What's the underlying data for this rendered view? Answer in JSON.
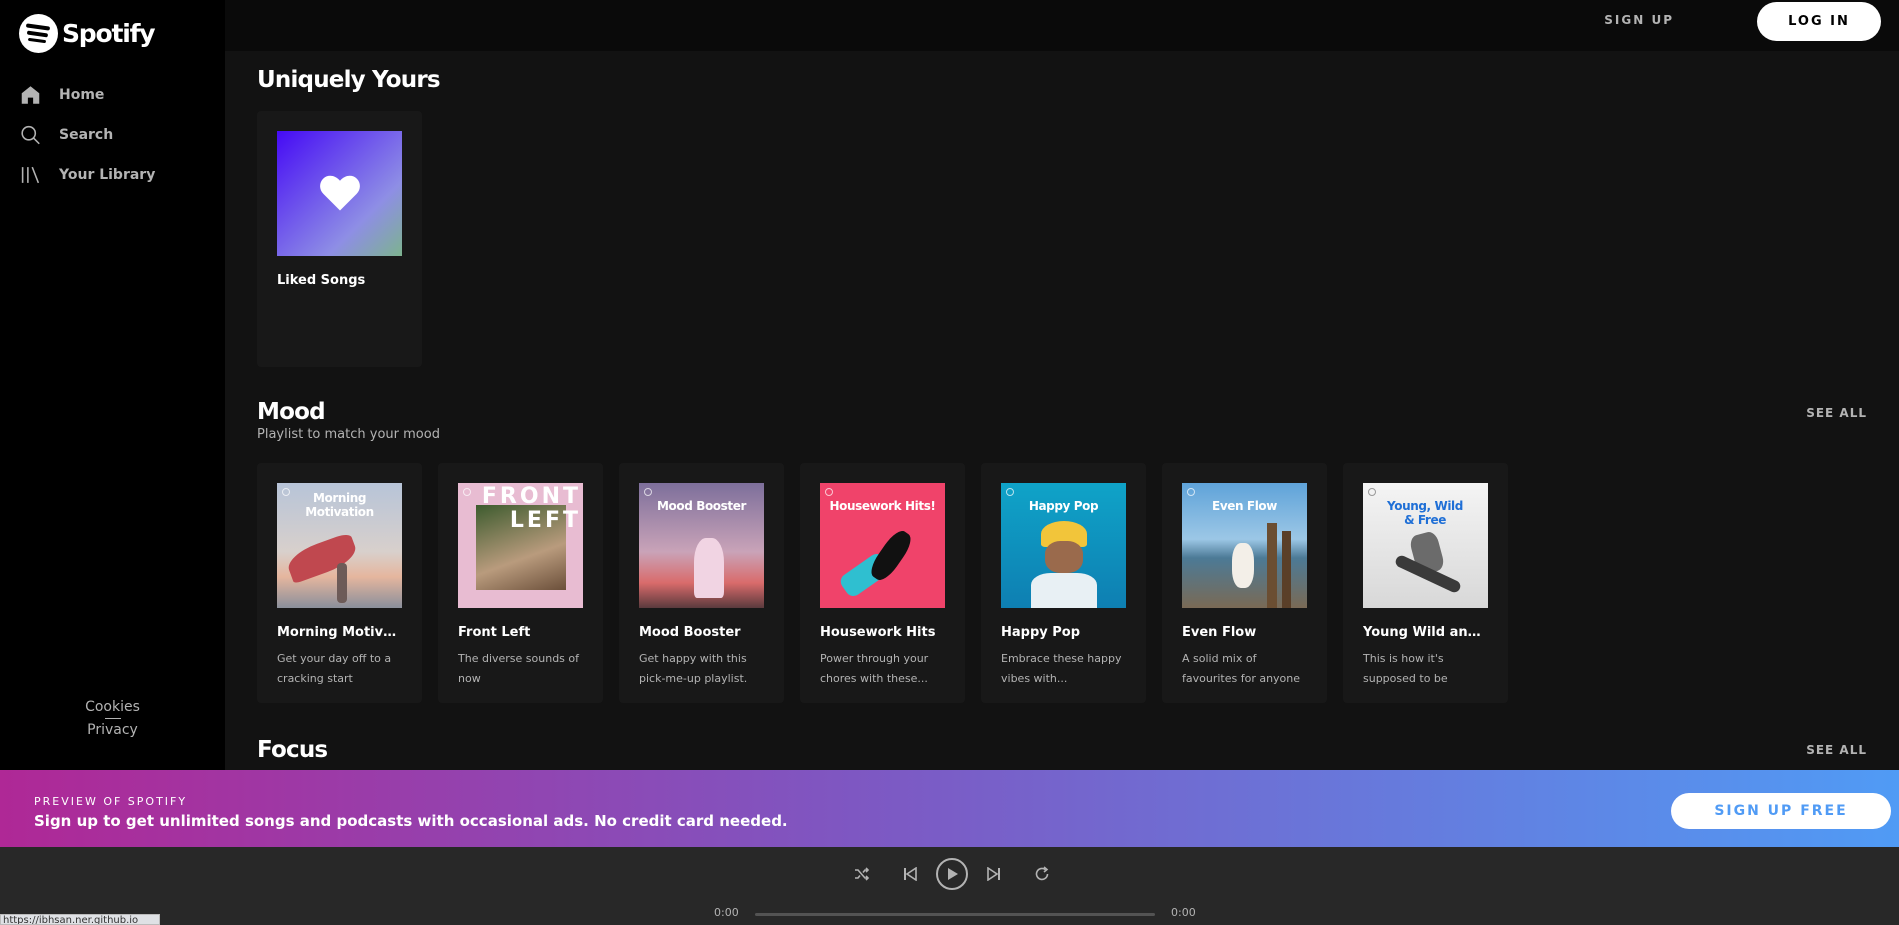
{
  "sidebar": {
    "logo_text": "Spotify",
    "items": [
      {
        "label": "Home",
        "icon": "home-icon"
      },
      {
        "label": "Search",
        "icon": "search-icon"
      },
      {
        "label": "Your Library",
        "icon": "library-icon"
      }
    ],
    "links": [
      "Cookies",
      "Privacy"
    ]
  },
  "topbar": {
    "signup_label": "SIGN UP",
    "login_label": "LOG IN"
  },
  "sections": {
    "uniquely": {
      "title": "Uniquely Yours",
      "cards": [
        {
          "title": "Liked Songs",
          "icon": "heart-icon"
        }
      ]
    },
    "mood": {
      "title": "Mood",
      "subtitle": "Playlist to match your mood",
      "see_all": "SEE ALL",
      "cards": [
        {
          "title": "Morning Motiva...",
          "desc": "Get your day off to a cracking start",
          "cover_text": "Morning Motivation"
        },
        {
          "title": "Front Left",
          "desc": "The diverse sounds of now",
          "cover_text": "FRONT LEFT"
        },
        {
          "title": "Mood Booster",
          "desc": "Get happy with this pick-me-up playlist.",
          "cover_text": "Mood Booster"
        },
        {
          "title": "Housework Hits",
          "desc": "Power through your chores with these...",
          "cover_text": "Housework Hits!"
        },
        {
          "title": "Happy Pop",
          "desc": "Embrace these happy vibes with...",
          "cover_text": "Happy Pop"
        },
        {
          "title": "Even Flow",
          "desc": "A solid mix of favourites for anyone",
          "cover_text": "Even Flow"
        },
        {
          "title": "Young Wild and...",
          "desc": "This is how it's supposed to be",
          "cover_text": "Young, Wild & Free"
        }
      ]
    },
    "focus": {
      "title": "Focus",
      "see_all": "SEE ALL"
    }
  },
  "banner": {
    "kicker": "PREVIEW OF SPOTIFY",
    "text": "Sign up to get unlimited songs and podcasts with occasional ads. No credit card needed.",
    "button": "SIGN UP FREE"
  },
  "player": {
    "time_current": "0:00",
    "time_total": "0:00",
    "controls": [
      "shuffle-icon",
      "previous-icon",
      "play-icon",
      "next-icon",
      "repeat-icon"
    ]
  },
  "status_url": "https://ibhsan.ner.github.io"
}
